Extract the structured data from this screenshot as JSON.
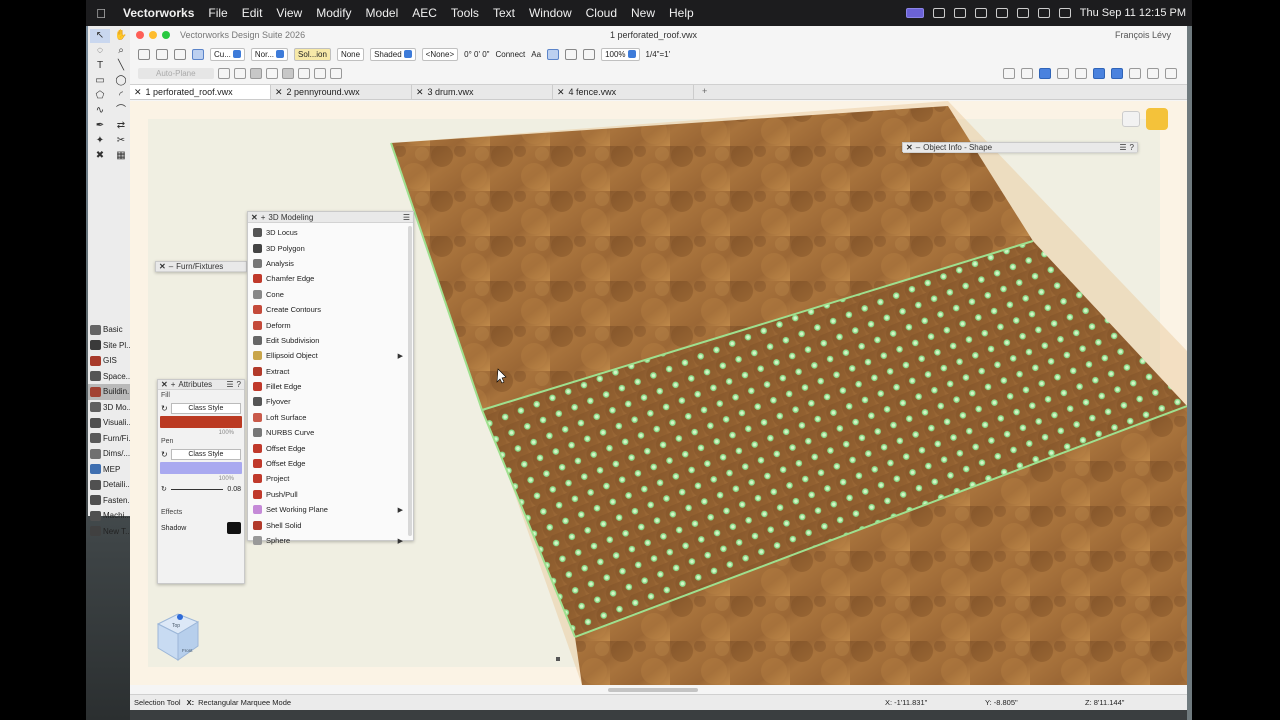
{
  "menubar": {
    "app": "Vectorworks",
    "items": [
      "File",
      "Edit",
      "View",
      "Modify",
      "Model",
      "AEC",
      "Tools",
      "Text",
      "Window",
      "Cloud",
      "New",
      "Help"
    ],
    "clock": "Thu Sep 11  12:15 PM"
  },
  "window": {
    "app_title": "Vectorworks Design Suite 2026",
    "file_title": "1 perforated_roof.vwx",
    "user": "François Lévy"
  },
  "toolbar": {
    "class_label": "Cu...",
    "layer_label": "Nor...",
    "render_mode": "Sol...ion",
    "none_label": "None",
    "shaded_label": "Shaded",
    "view_none": "<None>",
    "rotation": "0° 0' 0\"",
    "connect_label": "Connect",
    "font_size_icon": "Aa",
    "zoom": "100%",
    "scale": "1/4\"=1'",
    "auto_plane": "Auto-Plane"
  },
  "tabs": [
    {
      "label": "1 perforated_roof.vwx"
    },
    {
      "label": "2 pennyround.vwx"
    },
    {
      "label": "3 drum.vwx"
    },
    {
      "label": "4 fence.vwx"
    }
  ],
  "tab_add": "+",
  "tool_sets": [
    {
      "label": "Basic",
      "color": "#666666"
    },
    {
      "label": "Site Pl...",
      "color": "#3a3a3a"
    },
    {
      "label": "GIS",
      "color": "#a83a2a"
    },
    {
      "label": "Space...",
      "color": "#555555"
    },
    {
      "label": "Buildin...",
      "color": "#a24233"
    },
    {
      "label": "3D Mo...",
      "color": "#606060"
    },
    {
      "label": "Visuali...",
      "color": "#505050"
    },
    {
      "label": "Furn/Fi...",
      "color": "#5a5a5a"
    },
    {
      "label": "Dims/...",
      "color": "#707070"
    },
    {
      "label": "MEP",
      "color": "#3f6fb0"
    },
    {
      "label": "Detaili...",
      "color": "#505050"
    },
    {
      "label": "Fasten...",
      "color": "#505050"
    },
    {
      "label": "Machi...",
      "color": "#505050"
    },
    {
      "label": "New T...",
      "color": "#404040"
    }
  ],
  "palettes": {
    "furn_title": "Furn/Fixtures",
    "object_info_title": "Object Info - Shape",
    "modeling": {
      "title": "3D Modeling",
      "items": [
        {
          "label": "3D Locus",
          "color": "#555555",
          "submenu": false
        },
        {
          "label": "3D Polygon",
          "color": "#444444",
          "submenu": false
        },
        {
          "label": "Analysis",
          "color": "#777777",
          "submenu": false
        },
        {
          "label": "Chamfer Edge",
          "color": "#c0392b",
          "submenu": false
        },
        {
          "label": "Cone",
          "color": "#888888",
          "submenu": false
        },
        {
          "label": "Create Contours",
          "color": "#c44a3a",
          "submenu": false
        },
        {
          "label": "Deform",
          "color": "#c44a3a",
          "submenu": false
        },
        {
          "label": "Edit Subdivision",
          "color": "#666666",
          "submenu": false
        },
        {
          "label": "Ellipsoid Object",
          "color": "#c9a54a",
          "submenu": true
        },
        {
          "label": "Extract",
          "color": "#b23a2a",
          "submenu": false
        },
        {
          "label": "Fillet Edge",
          "color": "#c0392b",
          "submenu": false
        },
        {
          "label": "Flyover",
          "color": "#555555",
          "submenu": false
        },
        {
          "label": "Loft Surface",
          "color": "#c95a4a",
          "submenu": false
        },
        {
          "label": "NURBS Curve",
          "color": "#777777",
          "submenu": false
        },
        {
          "label": "Offset Edge",
          "color": "#c0392b",
          "submenu": false
        },
        {
          "label": "Offset Edge",
          "color": "#c0392b",
          "submenu": false
        },
        {
          "label": "Project",
          "color": "#c0392b",
          "submenu": false
        },
        {
          "label": "Push/Pull",
          "color": "#c0392b",
          "submenu": false
        },
        {
          "label": "Set Working Plane",
          "color": "#c58ad8",
          "submenu": true
        },
        {
          "label": "Shell Solid",
          "color": "#b23a2a",
          "submenu": false
        },
        {
          "label": "Sphere",
          "color": "#999999",
          "submenu": true
        }
      ]
    },
    "attributes": {
      "title": "Attributes",
      "fill_label": "Fill",
      "fill_style": "Class Style",
      "fill_color": "#bb3a22",
      "pen_label": "Pen",
      "pen_style": "Class Style",
      "pen_color": "#a9a9f0",
      "opacity": "100%",
      "thickness": "0.08",
      "effects_label": "Effects",
      "shadow_label": "Shadow"
    }
  },
  "statusbar": {
    "tool": "Selection Tool",
    "mode_key": "X:",
    "mode": "Rectangular Marquee Mode",
    "x": "X: -1'11.831\"",
    "y": "Y: -8.805\"",
    "z": "Z: 8'11.144\""
  },
  "viewcube": {
    "top_label": "Top",
    "front_label": "Front"
  }
}
